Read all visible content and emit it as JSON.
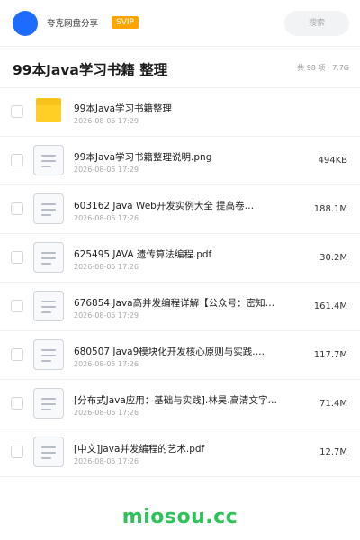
{
  "header": {
    "brand": "夸克网盘分享",
    "badge": "SVIP",
    "search_placeholder": "搜索",
    "avatar_color": "#1e6bff"
  },
  "title": {
    "text": "99本Java学习书籍 整理",
    "meta": "共 98 项 · 7.7G"
  },
  "files": [
    {
      "type": "folder",
      "icon": "folder-icon",
      "name": "99本Java学习书籍整理",
      "date": "2026-08-05 17:29",
      "size": ""
    },
    {
      "type": "file",
      "icon": "file-icon",
      "name": "99本Java学习书籍整理说明.png",
      "date": "2026-08-05 17:29",
      "size": "494KB"
    },
    {
      "type": "file",
      "icon": "file-icon",
      "name": "603162 Java Web开发实例大全 提高卷…",
      "date": "2026-08-05 17:26",
      "size": "188.1M"
    },
    {
      "type": "file",
      "icon": "file-icon",
      "name": "625495 JAVA 遗传算法编程.pdf",
      "date": "2026-08-05 17:26",
      "size": "30.2M"
    },
    {
      "type": "file",
      "icon": "file-icon",
      "name": "676854 Java高并发编程详解【公众号：密知…",
      "date": "2026-08-05 17:29",
      "size": "161.4M"
    },
    {
      "type": "file",
      "icon": "file-icon",
      "name": "680507 Java9模块化开发核心原则与实践.…",
      "date": "2026-08-05 17:26",
      "size": "117.7M"
    },
    {
      "type": "file",
      "icon": "file-icon",
      "name": "[分布式Java应用：基础与实践].林昊.高清文字…",
      "date": "2026-08-05 17:26",
      "size": "71.4M"
    },
    {
      "type": "file",
      "icon": "file-icon",
      "name": "[中文]Java并发编程的艺术.pdf",
      "date": "2026-08-05 17:26",
      "size": "12.7M"
    }
  ],
  "watermark": "miosou.cc",
  "colors": {
    "badge": "#ffa500",
    "folder": "#ffcf26",
    "watermark": "#2fc25b"
  }
}
